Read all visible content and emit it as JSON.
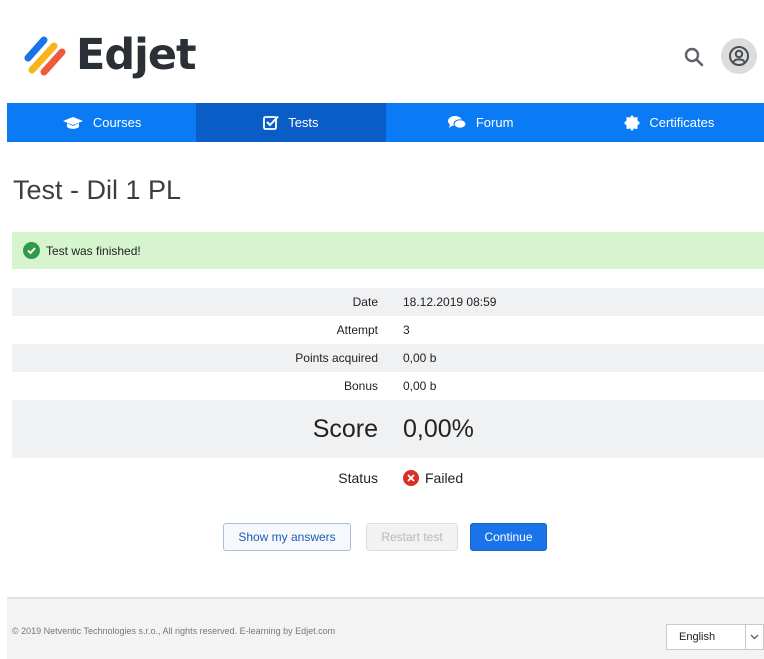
{
  "brand": {
    "name": "Edjet"
  },
  "header": {
    "search_icon": "search-icon",
    "avatar_icon": "user-avatar-icon"
  },
  "nav": {
    "items": [
      {
        "label": "Courses",
        "icon": "graduation-cap-icon",
        "active": false
      },
      {
        "label": "Tests",
        "icon": "checkbox-icon",
        "active": true
      },
      {
        "label": "Forum",
        "icon": "chat-bubbles-icon",
        "active": false
      },
      {
        "label": "Certificates",
        "icon": "certificate-badge-icon",
        "active": false
      }
    ]
  },
  "page": {
    "title": "Test - Dil 1 PL"
  },
  "alert": {
    "message": "Test was finished!",
    "icon": "check-circle-icon"
  },
  "results": {
    "date_label": "Date",
    "date_value": "18.12.2019 08:59",
    "attempt_label": "Attempt",
    "attempt_value": "3",
    "points_label": "Points acquired",
    "points_value": "0,00 b",
    "bonus_label": "Bonus",
    "bonus_value": "0,00 b",
    "score_label": "Score",
    "score_value": "0,00%",
    "status_label": "Status",
    "status_value": "Failed"
  },
  "actions": {
    "show_answers": "Show my answers",
    "restart": "Restart test",
    "continue": "Continue"
  },
  "footer": {
    "copyright": "© 2019 Netventic Technologies s.r.o., All rights reserved. E-learning by Edjet.com",
    "language": "English"
  },
  "colors": {
    "nav_bg": "#0a7bf5",
    "nav_active": "#0a5cc7",
    "success_bg": "#d6f5cf",
    "success_icon": "#2e9b47",
    "fail_icon": "#d93025",
    "primary_button": "#1a73e8"
  }
}
